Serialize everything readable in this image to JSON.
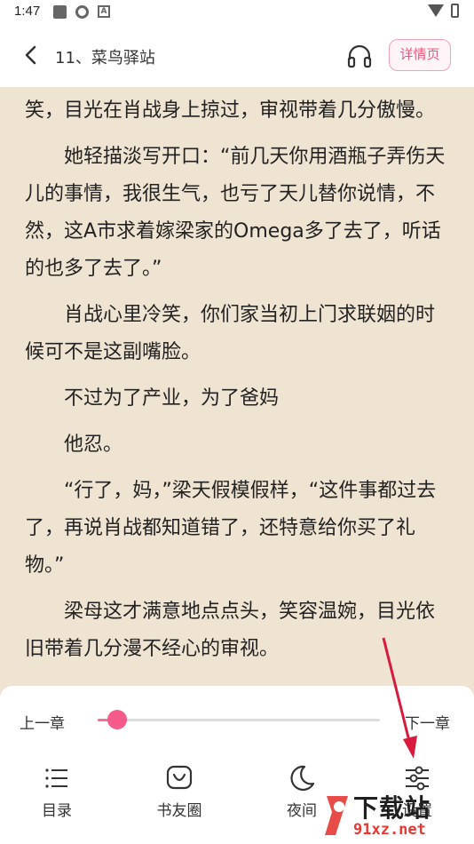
{
  "status_bar": {
    "time": "1:47"
  },
  "header": {
    "title": "11、菜鸟驿站",
    "detail_label": "详情页"
  },
  "content": {
    "paragraphs": [
      {
        "text": "笑，目光在肖战身上掠过，审视带着几分傲慢。",
        "indent": false
      },
      {
        "text": "她轻描淡写开口：“前几天你用酒瓶子弄伤天儿的事情，我很生气，也亏了天儿替你说情，不然，这A市求着嫁梁家的Omega多了去了，听话的也多了去了。”",
        "indent": true
      },
      {
        "text": "肖战心里冷笑，你们家当初上门求联姻的时候可不是这副嘴脸。",
        "indent": true
      },
      {
        "text": "不过为了产业，为了爸妈",
        "indent": true
      },
      {
        "text": "他忍。",
        "indent": true
      },
      {
        "text": "“行了，妈，”梁天假模假样，“这件事都过去了，再说肖战都知道错了，还特意给你买了礼物。”",
        "indent": true
      },
      {
        "text": "梁母这才满意地点点头，笑容温婉，目光依旧带着几分漫不经心的审视。",
        "indent": true
      }
    ]
  },
  "panel": {
    "prev_label": "上一章",
    "next_label": "下一章",
    "progress_fraction": 0.07,
    "tools": [
      {
        "label": "目录",
        "icon": "list-icon"
      },
      {
        "label": "书友圈",
        "icon": "chat-bubble-icon"
      },
      {
        "label": "夜间",
        "icon": "moon-icon"
      },
      {
        "label": "设置",
        "icon": "sliders-icon"
      }
    ]
  },
  "watermark": {
    "text": "下载站",
    "url": "91xz.net"
  },
  "colors": {
    "accent": "#f45b8a",
    "paper": "#efe3d2",
    "annotation_arrow": "#d81b3c"
  }
}
